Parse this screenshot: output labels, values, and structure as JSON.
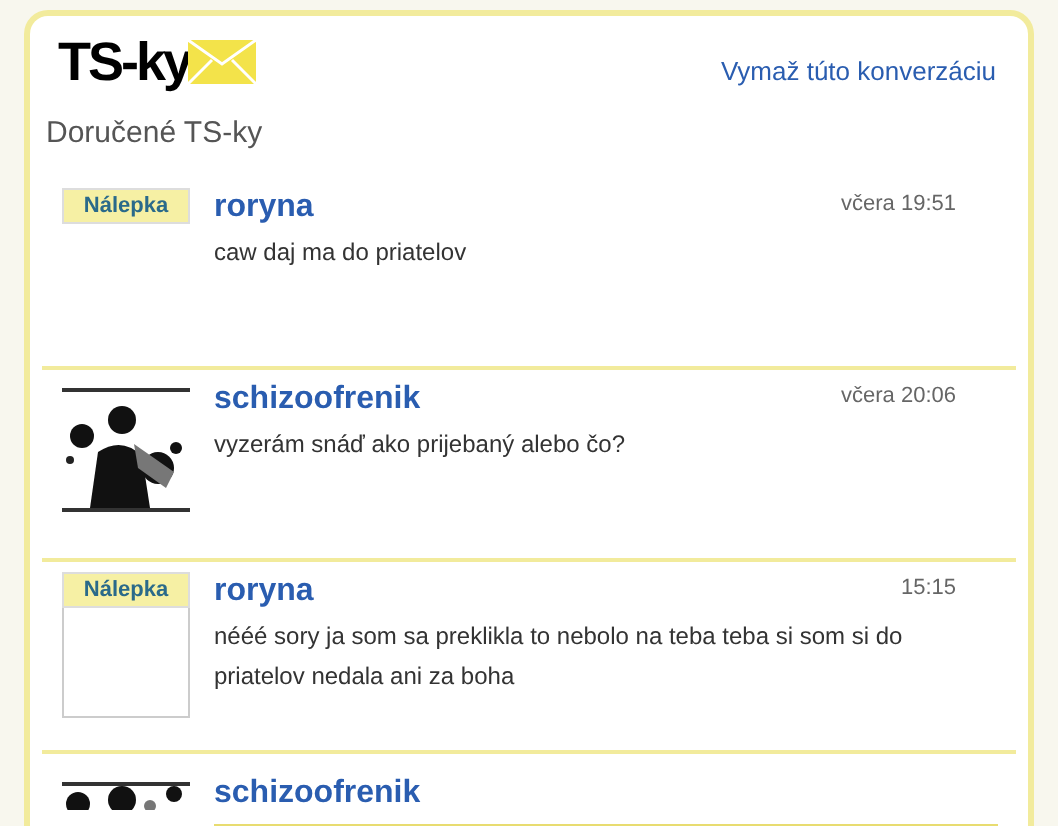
{
  "logo": {
    "text": "TS-ky"
  },
  "delete_link": "Vymaž túto konverzáciu",
  "heading": "Doručené TS-ky",
  "messages": [
    {
      "kind": "sticker",
      "sticker_label": "Nálepka",
      "framed": false,
      "author": "roryna",
      "time": "včera 19:51",
      "text": "caw daj ma do priatelov"
    },
    {
      "kind": "avatar",
      "author": "schizoofrenik",
      "time": "včera 20:06",
      "text": "vyzerám snáď ako prijebaný alebo čo?"
    },
    {
      "kind": "sticker",
      "sticker_label": "Nálepka",
      "framed": true,
      "author": "roryna",
      "time": "15:15",
      "text": "nééé sory ja som sa preklikla to nebolo na teba teba si som si do priatelov nedala ani za boha"
    },
    {
      "kind": "reply",
      "author": "schizoofrenik"
    }
  ]
}
